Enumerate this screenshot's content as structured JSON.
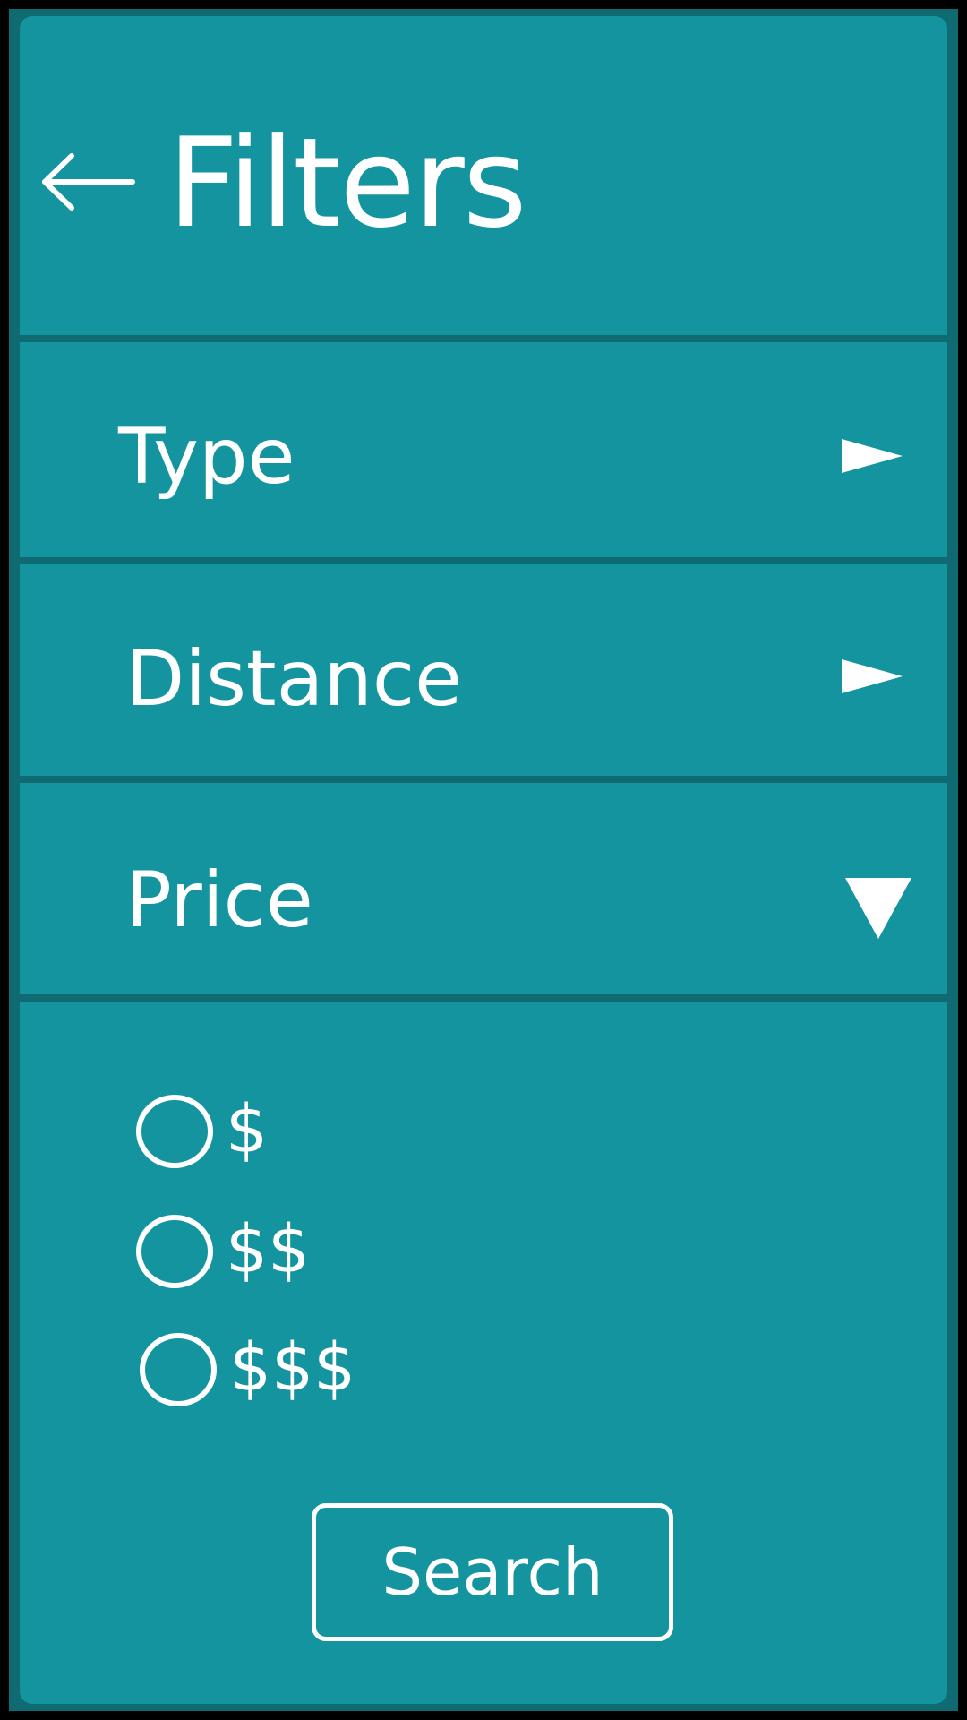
{
  "header": {
    "back_icon": "arrow-left-icon",
    "title": "Filters"
  },
  "filters": {
    "type": {
      "label": "Type",
      "icon": "caret-right-icon",
      "expanded": false
    },
    "distance": {
      "label": "Distance",
      "icon": "caret-right-icon",
      "expanded": false
    },
    "price": {
      "label": "Price",
      "icon": "caret-down-icon",
      "expanded": true
    }
  },
  "price_options": [
    {
      "label": "$",
      "selected": false
    },
    {
      "label": "$$",
      "selected": false
    },
    {
      "label": "$$$",
      "selected": false
    }
  ],
  "search_button": {
    "label": "Search"
  },
  "colors": {
    "background": "#14949e",
    "divider": "#0f6a72",
    "outer_border": "#000000",
    "foreground": "#ffffff"
  }
}
